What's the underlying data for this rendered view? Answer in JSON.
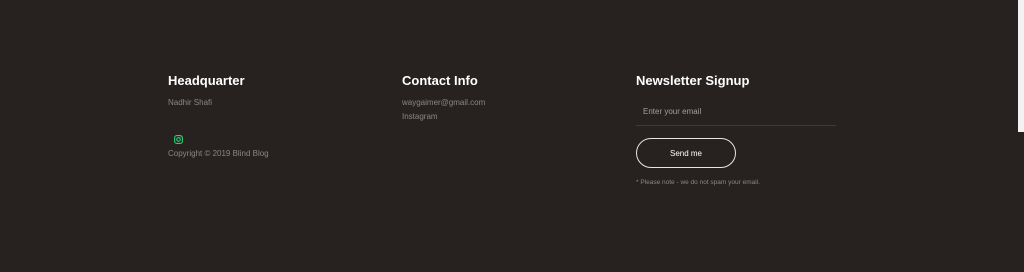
{
  "footer": {
    "headquarter": {
      "title": "Headquarter",
      "name": "Nadhir Shafi",
      "social_icon": "instagram-icon",
      "copyright": "Copyright © 2019 Blind Blog"
    },
    "contact": {
      "title": "Contact Info",
      "email": "waygaimer@gmail.com",
      "instagram": "Instagram"
    },
    "newsletter": {
      "title": "Newsletter Signup",
      "email_placeholder": "Enter your email",
      "button_label": "Send me",
      "note": "* Please note - we do not spam your email."
    }
  },
  "colors": {
    "background": "#272220",
    "heading": "#ffffff",
    "muted_text": "#8b8684",
    "accent_green": "#2ecc71"
  }
}
